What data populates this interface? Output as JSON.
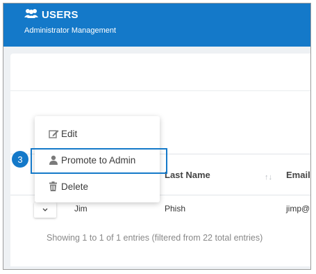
{
  "header": {
    "title": "USERS",
    "subtitle": "Administrator Management",
    "icon": "users-icon"
  },
  "table": {
    "columns": [
      "Last Name",
      "Email"
    ],
    "rows": [
      {
        "first_name": "Jim",
        "last_name": "Phish",
        "email": "jimp@"
      }
    ],
    "info": "Showing 1 to 1 of 1 entries (filtered from 22 total entries)"
  },
  "menu": {
    "items": [
      {
        "label": "Edit",
        "icon": "edit-icon"
      },
      {
        "label": "Promote to Admin",
        "icon": "user-icon"
      },
      {
        "label": "Delete",
        "icon": "trash-icon"
      }
    ]
  },
  "callout": {
    "step": "3",
    "color": "#1479c9"
  },
  "colors": {
    "header": "#1479c9"
  }
}
